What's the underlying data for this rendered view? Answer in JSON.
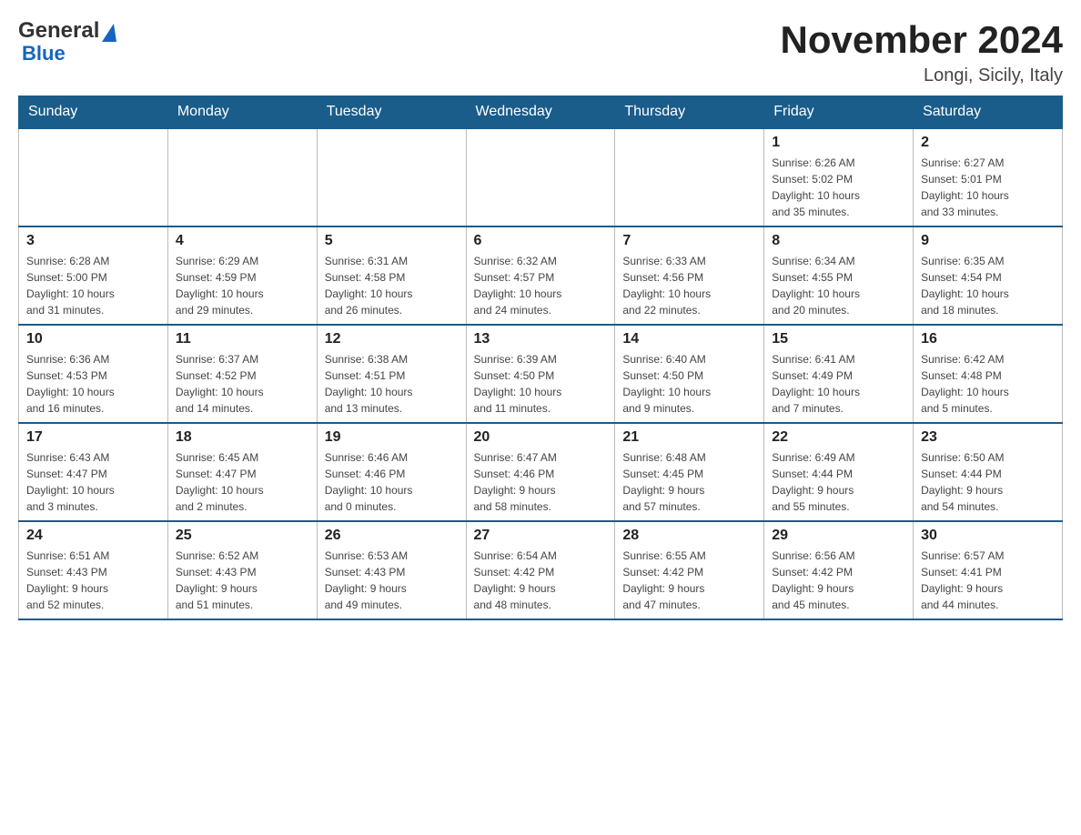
{
  "header": {
    "logo": {
      "general": "General",
      "blue": "Blue"
    },
    "title": "November 2024",
    "location": "Longi, Sicily, Italy"
  },
  "weekdays": [
    "Sunday",
    "Monday",
    "Tuesday",
    "Wednesday",
    "Thursday",
    "Friday",
    "Saturday"
  ],
  "weeks": [
    [
      {
        "day": "",
        "info": ""
      },
      {
        "day": "",
        "info": ""
      },
      {
        "day": "",
        "info": ""
      },
      {
        "day": "",
        "info": ""
      },
      {
        "day": "",
        "info": ""
      },
      {
        "day": "1",
        "info": "Sunrise: 6:26 AM\nSunset: 5:02 PM\nDaylight: 10 hours\nand 35 minutes."
      },
      {
        "day": "2",
        "info": "Sunrise: 6:27 AM\nSunset: 5:01 PM\nDaylight: 10 hours\nand 33 minutes."
      }
    ],
    [
      {
        "day": "3",
        "info": "Sunrise: 6:28 AM\nSunset: 5:00 PM\nDaylight: 10 hours\nand 31 minutes."
      },
      {
        "day": "4",
        "info": "Sunrise: 6:29 AM\nSunset: 4:59 PM\nDaylight: 10 hours\nand 29 minutes."
      },
      {
        "day": "5",
        "info": "Sunrise: 6:31 AM\nSunset: 4:58 PM\nDaylight: 10 hours\nand 26 minutes."
      },
      {
        "day": "6",
        "info": "Sunrise: 6:32 AM\nSunset: 4:57 PM\nDaylight: 10 hours\nand 24 minutes."
      },
      {
        "day": "7",
        "info": "Sunrise: 6:33 AM\nSunset: 4:56 PM\nDaylight: 10 hours\nand 22 minutes."
      },
      {
        "day": "8",
        "info": "Sunrise: 6:34 AM\nSunset: 4:55 PM\nDaylight: 10 hours\nand 20 minutes."
      },
      {
        "day": "9",
        "info": "Sunrise: 6:35 AM\nSunset: 4:54 PM\nDaylight: 10 hours\nand 18 minutes."
      }
    ],
    [
      {
        "day": "10",
        "info": "Sunrise: 6:36 AM\nSunset: 4:53 PM\nDaylight: 10 hours\nand 16 minutes."
      },
      {
        "day": "11",
        "info": "Sunrise: 6:37 AM\nSunset: 4:52 PM\nDaylight: 10 hours\nand 14 minutes."
      },
      {
        "day": "12",
        "info": "Sunrise: 6:38 AM\nSunset: 4:51 PM\nDaylight: 10 hours\nand 13 minutes."
      },
      {
        "day": "13",
        "info": "Sunrise: 6:39 AM\nSunset: 4:50 PM\nDaylight: 10 hours\nand 11 minutes."
      },
      {
        "day": "14",
        "info": "Sunrise: 6:40 AM\nSunset: 4:50 PM\nDaylight: 10 hours\nand 9 minutes."
      },
      {
        "day": "15",
        "info": "Sunrise: 6:41 AM\nSunset: 4:49 PM\nDaylight: 10 hours\nand 7 minutes."
      },
      {
        "day": "16",
        "info": "Sunrise: 6:42 AM\nSunset: 4:48 PM\nDaylight: 10 hours\nand 5 minutes."
      }
    ],
    [
      {
        "day": "17",
        "info": "Sunrise: 6:43 AM\nSunset: 4:47 PM\nDaylight: 10 hours\nand 3 minutes."
      },
      {
        "day": "18",
        "info": "Sunrise: 6:45 AM\nSunset: 4:47 PM\nDaylight: 10 hours\nand 2 minutes."
      },
      {
        "day": "19",
        "info": "Sunrise: 6:46 AM\nSunset: 4:46 PM\nDaylight: 10 hours\nand 0 minutes."
      },
      {
        "day": "20",
        "info": "Sunrise: 6:47 AM\nSunset: 4:46 PM\nDaylight: 9 hours\nand 58 minutes."
      },
      {
        "day": "21",
        "info": "Sunrise: 6:48 AM\nSunset: 4:45 PM\nDaylight: 9 hours\nand 57 minutes."
      },
      {
        "day": "22",
        "info": "Sunrise: 6:49 AM\nSunset: 4:44 PM\nDaylight: 9 hours\nand 55 minutes."
      },
      {
        "day": "23",
        "info": "Sunrise: 6:50 AM\nSunset: 4:44 PM\nDaylight: 9 hours\nand 54 minutes."
      }
    ],
    [
      {
        "day": "24",
        "info": "Sunrise: 6:51 AM\nSunset: 4:43 PM\nDaylight: 9 hours\nand 52 minutes."
      },
      {
        "day": "25",
        "info": "Sunrise: 6:52 AM\nSunset: 4:43 PM\nDaylight: 9 hours\nand 51 minutes."
      },
      {
        "day": "26",
        "info": "Sunrise: 6:53 AM\nSunset: 4:43 PM\nDaylight: 9 hours\nand 49 minutes."
      },
      {
        "day": "27",
        "info": "Sunrise: 6:54 AM\nSunset: 4:42 PM\nDaylight: 9 hours\nand 48 minutes."
      },
      {
        "day": "28",
        "info": "Sunrise: 6:55 AM\nSunset: 4:42 PM\nDaylight: 9 hours\nand 47 minutes."
      },
      {
        "day": "29",
        "info": "Sunrise: 6:56 AM\nSunset: 4:42 PM\nDaylight: 9 hours\nand 45 minutes."
      },
      {
        "day": "30",
        "info": "Sunrise: 6:57 AM\nSunset: 4:41 PM\nDaylight: 9 hours\nand 44 minutes."
      }
    ]
  ]
}
